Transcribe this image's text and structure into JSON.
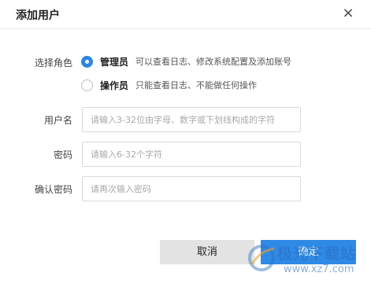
{
  "dialog": {
    "title": "添加用户",
    "close_icon": "close-icon"
  },
  "role": {
    "label": "选择角色",
    "options": [
      {
        "name": "管理员",
        "desc": "可以查看日志、修改系统配置及添加账号",
        "checked": true
      },
      {
        "name": "操作员",
        "desc": "只能查看日志、不能做任何操作",
        "checked": false
      }
    ]
  },
  "username": {
    "label": "用户名",
    "placeholder": "请输入3-32位由字母、数字或下划线构成的字符",
    "value": ""
  },
  "password": {
    "label": "密码",
    "placeholder": "请输入6-32个字符",
    "value": ""
  },
  "confirm_password": {
    "label": "确认密码",
    "placeholder": "请再次输入密码",
    "value": ""
  },
  "buttons": {
    "cancel": "取消",
    "ok": "确定"
  },
  "watermark": {
    "line1": "极光下载站",
    "line2": "www.xz7.com"
  },
  "colors": {
    "accent": "#2f8ae6",
    "cancel_bg": "#e3e3e3"
  }
}
